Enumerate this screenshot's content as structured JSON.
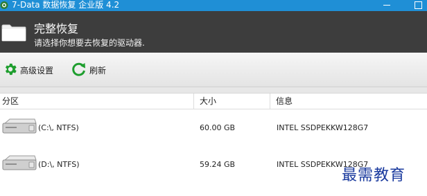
{
  "window": {
    "title": "7-Data 数据恢复 企业版 4.2"
  },
  "header": {
    "title": "完整恢复",
    "subtitle": "请选择你想要去恢复的驱动器."
  },
  "toolbar": {
    "advanced_label": "高级设置",
    "refresh_label": "刷新"
  },
  "table": {
    "columns": [
      "分区",
      "大小",
      "信息"
    ],
    "rows": [
      {
        "name": "(C:\\, NTFS)",
        "size": "60.00 GB",
        "info": "INTEL SSDPEKKW128G7"
      },
      {
        "name": "(D:\\, NTFS)",
        "size": "59.24 GB",
        "info": "INTEL SSDPEKKW128G7"
      }
    ]
  },
  "watermark": "最需教育",
  "colors": {
    "titlebar": "#1f8fd6",
    "header": "#3d3d3d",
    "accent_green": "#1e9e2e"
  }
}
